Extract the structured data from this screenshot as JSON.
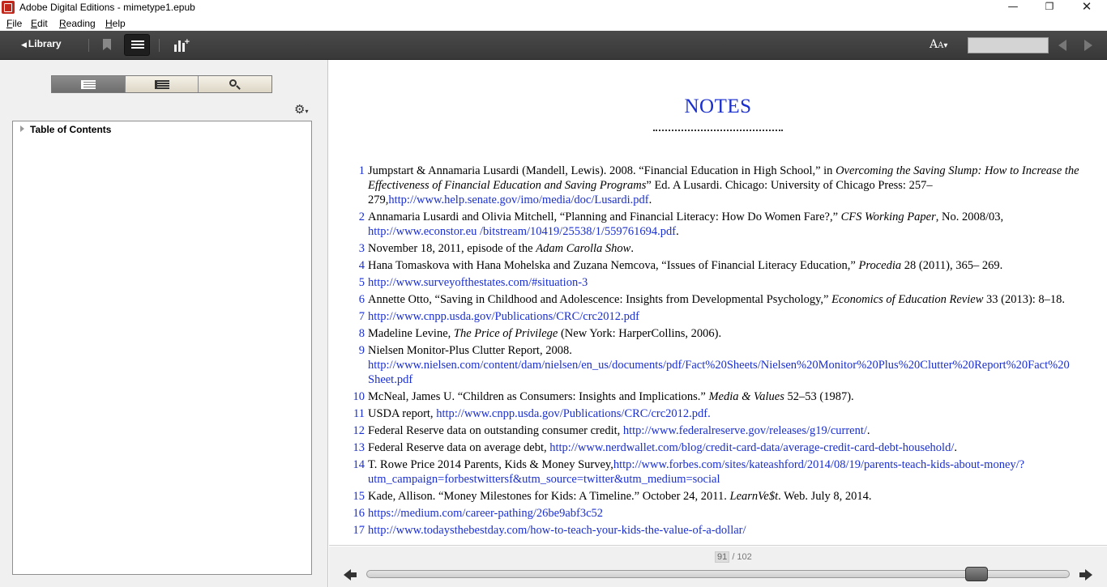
{
  "window": {
    "title": "Adobe Digital Editions - mimetype1.epub",
    "minimize": "—",
    "maximize": "❐",
    "close": "✕"
  },
  "menu": [
    "File",
    "Edit",
    "Reading",
    "Help"
  ],
  "toolbar": {
    "library_label": "Library",
    "library_arrow": "◀",
    "font_size_label": "A",
    "font_size_small": "A",
    "search_value": ""
  },
  "sidebar": {
    "toc_label": "Table of Contents"
  },
  "content": {
    "title": "NOTES",
    "notes": [
      {
        "num": "1",
        "parts": [
          {
            "t": "Jumpstart & Annamaria Lusardi (Mandell, Lewis). 2008. “Financial Education in High School,” in "
          },
          {
            "t": "Overcoming the Saving Slump: How to Increase the Effectiveness of Financial Education and Saving Programs",
            "s": "i"
          },
          {
            "t": "” Ed. A Lusardi. Chicago: University of Chicago Press: 257–279,"
          },
          {
            "t": "http://www.help.senate.gov/imo/media/doc/Lusardi.pdf",
            "s": "link"
          },
          {
            "t": "."
          }
        ]
      },
      {
        "num": "2",
        "parts": [
          {
            "t": "Annamaria Lusardi and Olivia Mitchell, “Planning and Financial Literacy: How Do Women Fare?,” "
          },
          {
            "t": "CFS Working Paper",
            "s": "i"
          },
          {
            "t": ", No. 2008/03, "
          },
          {
            "t": "http://www.econstor.eu /bitstream/10419/25538/1/559761694.pdf",
            "s": "link"
          },
          {
            "t": "."
          }
        ]
      },
      {
        "num": "3",
        "parts": [
          {
            "t": "November 18, 2011, episode of the "
          },
          {
            "t": "Adam Carolla Show",
            "s": "i"
          },
          {
            "t": "."
          }
        ]
      },
      {
        "num": "4",
        "parts": [
          {
            "t": "Hana Tomaskova with Hana Mohelska and Zuzana Nemcova, “Issues of Financial Literacy Education,” "
          },
          {
            "t": "Procedia",
            "s": "i"
          },
          {
            "t": " 28 (2011), 365– 269."
          }
        ]
      },
      {
        "num": "5",
        "parts": [
          {
            "t": "http://www.surveyofthestates.com/#situation-3",
            "s": "link"
          }
        ]
      },
      {
        "num": "6",
        "parts": [
          {
            "t": "Annette Otto, “Saving in Childhood and Adolescence: Insights from Developmental Psychology,” "
          },
          {
            "t": "Economics of Education Review",
            "s": "i"
          },
          {
            "t": " 33 (2013): 8–18."
          }
        ]
      },
      {
        "num": "7",
        "parts": [
          {
            "t": "http://www.cnpp.usda.gov/Publications/CRC/crc2012.pdf",
            "s": "link"
          }
        ]
      },
      {
        "num": "8",
        "parts": [
          {
            "t": "Madeline Levine, "
          },
          {
            "t": "The Price of Privilege",
            "s": "i"
          },
          {
            "t": " (New York: HarperCollins, 2006)."
          }
        ]
      },
      {
        "num": "9",
        "parts": [
          {
            "t": "Nielsen Monitor-Plus Clutter Report, 2008. "
          },
          {
            "t": "http://www.nielsen.com/content/dam/nielsen/en_us/documents/pdf/Fact%20Sheets/Nielsen%20Monitor%20Plus%20Clutter%20Report%20Fact%20 Sheet.pdf",
            "s": "link"
          }
        ]
      },
      {
        "num": "10",
        "parts": [
          {
            "t": "McNeal, James U. “Children as Consumers: Insights and Implications.” "
          },
          {
            "t": "Media & Values",
            "s": "i"
          },
          {
            "t": " 52–53 (1987)."
          }
        ]
      },
      {
        "num": "11",
        "parts": [
          {
            "t": "USDA report, "
          },
          {
            "t": "http://www.cnpp.usda.gov/Publications/CRC/crc2012.pdf.",
            "s": "link"
          }
        ]
      },
      {
        "num": "12",
        "parts": [
          {
            "t": "Federal Reserve data on outstanding consumer credit, "
          },
          {
            "t": "http://www.federalreserve.gov/releases/g19/current/",
            "s": "link"
          },
          {
            "t": "."
          }
        ]
      },
      {
        "num": "13",
        "parts": [
          {
            "t": "Federal Reserve data on average debt, "
          },
          {
            "t": "http://www.nerdwallet.com/blog/credit-card-data/average-credit-card-debt-household/",
            "s": "link"
          },
          {
            "t": "."
          }
        ]
      },
      {
        "num": "14",
        "parts": [
          {
            "t": "T. Rowe Price 2014 Parents, Kids & Money Survey,"
          },
          {
            "t": "http://www.forbes.com/sites/kateashford/2014/08/19/parents-teach-kids-about-money/?utm_campaign=forbestwittersf&utm_source=twitter&utm_medium=social",
            "s": "link"
          }
        ]
      },
      {
        "num": "15",
        "parts": [
          {
            "t": "Kade, Allison. “Money Milestones for Kids: A Timeline.” October 24, 2011. "
          },
          {
            "t": "LearnVe$t",
            "s": "i"
          },
          {
            "t": ". Web. July 8, 2014."
          }
        ]
      },
      {
        "num": "16",
        "parts": [
          {
            "t": "https://medium.com/career-pathing/26be9abf3c52",
            "s": "link"
          }
        ]
      },
      {
        "num": "17",
        "parts": [
          {
            "t": "http://www.todaysthebestday.com/how-to-teach-your-kids-the-value-of-a-dollar/",
            "s": "link"
          }
        ]
      }
    ]
  },
  "pagination": {
    "current_page": "91",
    "total_pages": "/ 102",
    "progress": 0.88
  }
}
